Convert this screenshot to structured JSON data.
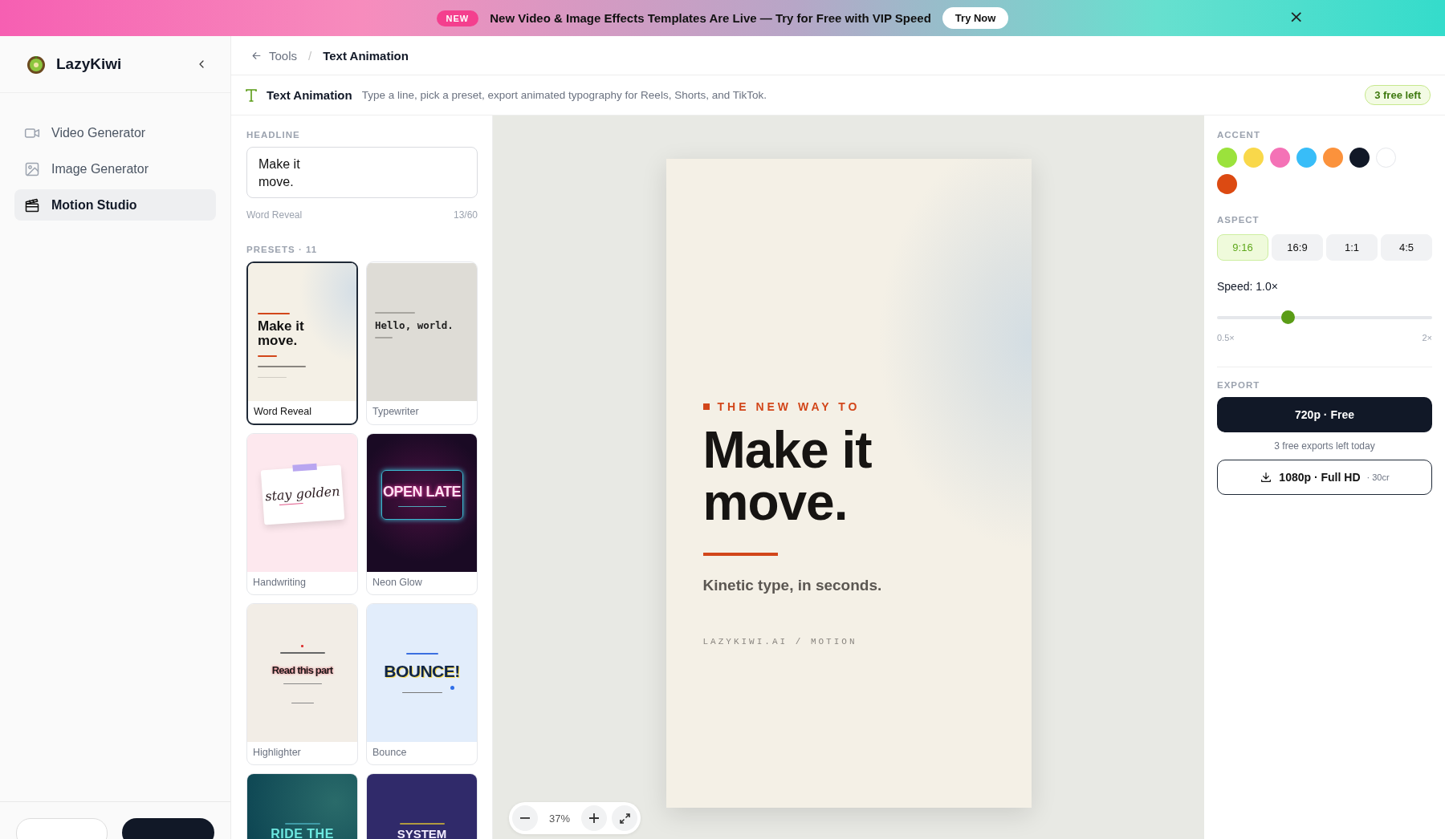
{
  "banner": {
    "badge": "NEW",
    "message": "New Video & Image Effects Templates Are Live — Try for Free with **VIP Speed**",
    "button": "Try Now",
    "close": "×"
  },
  "sidebar": {
    "brand": "LazyKiwi",
    "items": [
      {
        "label": "Video Generator",
        "selected": false
      },
      {
        "label": "Image Generator",
        "selected": false
      },
      {
        "label": "Motion Studio",
        "selected": true
      }
    ]
  },
  "breadcrumb": {
    "back": "Tools",
    "separator": "/",
    "current": "Text Animation"
  },
  "tool_header": {
    "title": "Text Animation",
    "description": "Type a line, pick a preset, export animated typography for Reels, Shorts, and TikTok.",
    "badge": "3 free left"
  },
  "headline": {
    "label": "HEADLINE",
    "value": "Make it\nmove.",
    "preset_name": "Word Reveal",
    "count": "13/60"
  },
  "presets": {
    "label": "PRESETS · 11",
    "items": [
      {
        "name": "Word Reveal",
        "kind": "reveal",
        "selected": true,
        "headline": "Make it move."
      },
      {
        "name": "Typewriter",
        "kind": "typewriter",
        "selected": false,
        "headline": "Hello, world."
      },
      {
        "name": "Handwriting",
        "kind": "handwriting",
        "selected": false,
        "headline": "stay golden"
      },
      {
        "name": "Neon Glow",
        "kind": "neon",
        "selected": false,
        "headline": "OPEN LATE"
      },
      {
        "name": "Highlighter",
        "kind": "highlighter",
        "selected": false,
        "headline": "Read this part"
      },
      {
        "name": "Bounce",
        "kind": "bounce",
        "selected": false,
        "headline": "BOUNCE!"
      },
      {
        "kind": "surf",
        "selected": false,
        "headline": "RIDE THE"
      },
      {
        "kind": "glitch",
        "selected": false,
        "headline": "SYSTEM"
      }
    ]
  },
  "canvas": {
    "eyebrow": "THE NEW WAY TO",
    "headline": "Make it\nmove.",
    "subline": "Kinetic type, in seconds.",
    "footer": "LAZYKIWI.AI / MOTION",
    "zoom": "37%"
  },
  "accent": {
    "label": "ACCENT",
    "colors": [
      {
        "color": "#9be23c"
      },
      {
        "color": "#f9d84a"
      },
      {
        "color": "#f472b6"
      },
      {
        "color": "#38bdf8"
      },
      {
        "color": "#fb923c"
      },
      {
        "color": "#111827"
      },
      {
        "color": "#ffffff"
      },
      {
        "color": "#dc4a12"
      }
    ]
  },
  "aspect": {
    "label": "ASPECT",
    "options": [
      {
        "label": "9:16",
        "selected": true
      },
      {
        "label": "16:9",
        "selected": false
      },
      {
        "label": "1:1",
        "selected": false
      },
      {
        "label": "4:5",
        "selected": false
      }
    ]
  },
  "speed": {
    "label": "Speed: 1.0×",
    "level": 0.33,
    "min": "0.5×",
    "max": "2×"
  },
  "export": {
    "label": "EXPORT",
    "primary": "720p · Free",
    "note": "3 free exports left today",
    "secondary": "1080p · Full HD",
    "secondary_cost": "· 30cr"
  }
}
